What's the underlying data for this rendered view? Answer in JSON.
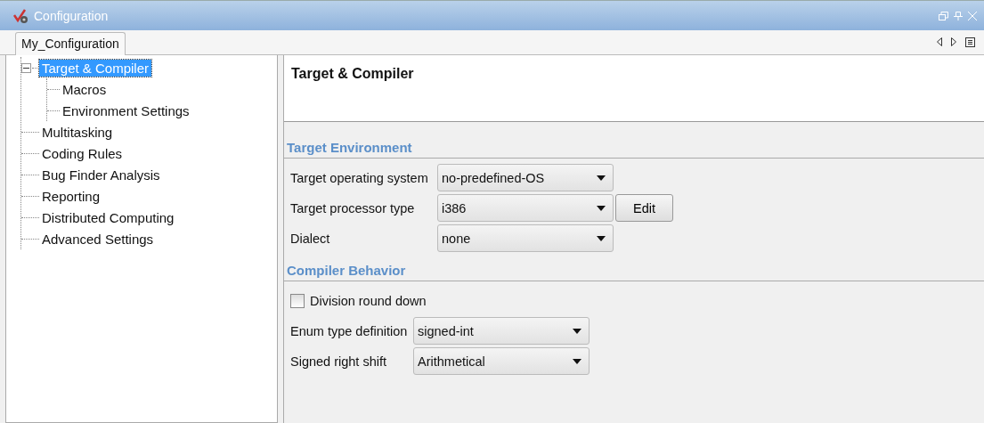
{
  "window": {
    "title": "Configuration"
  },
  "tabs": [
    {
      "label": "My_Configuration",
      "selected": true
    }
  ],
  "tree": [
    {
      "label": "Target & Compiler",
      "selected": true,
      "expanded": true,
      "children": [
        {
          "label": "Macros",
          "selected": false
        },
        {
          "label": "Environment Settings",
          "selected": false
        }
      ]
    },
    {
      "label": "Multitasking",
      "selected": false
    },
    {
      "label": "Coding Rules",
      "selected": false
    },
    {
      "label": "Bug Finder Analysis",
      "selected": false
    },
    {
      "label": "Reporting",
      "selected": false
    },
    {
      "label": "Distributed Computing",
      "selected": false
    },
    {
      "label": "Advanced Settings",
      "selected": false
    }
  ],
  "panel": {
    "title": "Target & Compiler",
    "sections": [
      {
        "title": "Target Environment",
        "rows": [
          {
            "kind": "dropdown",
            "label": "Target operating system",
            "value": "no-predefined-OS"
          },
          {
            "kind": "dropdown",
            "label": "Target processor type",
            "value": "i386",
            "button": "Edit"
          },
          {
            "kind": "dropdown",
            "label": "Dialect",
            "value": "none"
          }
        ]
      },
      {
        "title": "Compiler Behavior",
        "rows": [
          {
            "kind": "checkbox",
            "label": "Division round down",
            "checked": false
          },
          {
            "kind": "dropdown",
            "label": "Enum type definition",
            "value": "signed-int"
          },
          {
            "kind": "dropdown",
            "label": "Signed right shift",
            "value": "Arithmetical"
          }
        ]
      }
    ]
  }
}
